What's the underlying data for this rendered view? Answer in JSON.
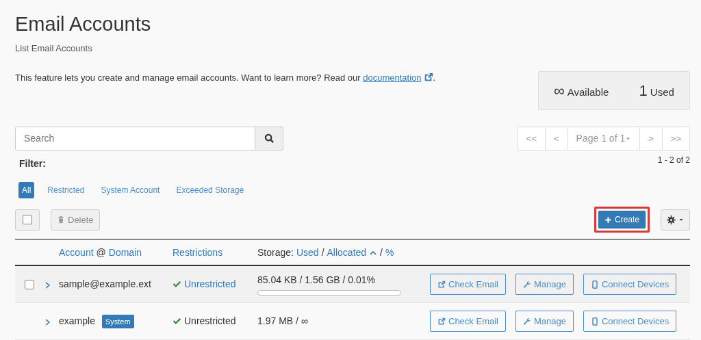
{
  "title": "Email Accounts",
  "subtitle": "List Email Accounts",
  "description": {
    "text": "This feature lets you create and manage email accounts. Want to learn more? Read our ",
    "link": "documentation",
    "end": "."
  },
  "stats": [
    {
      "value": "∞",
      "label": "Available"
    },
    {
      "value": "1",
      "label": "Used"
    }
  ],
  "search": {
    "placeholder": "Search"
  },
  "pagination": {
    "buttons": [
      {
        "label": "<<",
        "kind": "nav"
      },
      {
        "label": "<",
        "kind": "nav"
      },
      {
        "label": "Page 1 of 1",
        "kind": "dropdown"
      },
      {
        "label": ">",
        "kind": "nav"
      },
      {
        "label": ">>",
        "kind": "nav"
      }
    ],
    "count": "1 - 2 of 2"
  },
  "filter": {
    "label": "Filter:",
    "options": [
      {
        "label": "All",
        "selected": true
      },
      {
        "label": "Restricted",
        "selected": false
      },
      {
        "label": "System Account",
        "selected": false
      },
      {
        "label": "Exceeded Storage",
        "selected": false
      }
    ]
  },
  "toolbar": {
    "select_all_checked": false,
    "delete": {
      "label": "Delete",
      "disabled": true
    },
    "create": {
      "label": "Create",
      "highlighted": true
    }
  },
  "columns": [
    [
      {
        "text": "Account",
        "link": true
      },
      {
        "text": "@",
        "link": false
      },
      {
        "text": "Domain",
        "link": true
      }
    ],
    [
      {
        "text": "Restrictions",
        "link": true
      }
    ],
    [
      {
        "text": "Storage:",
        "link": false
      },
      {
        "text": "Used",
        "link": true
      },
      {
        "text": "/",
        "link": false
      },
      {
        "text": "Allocated",
        "link": true,
        "sorted": true
      },
      {
        "text": "/",
        "link": false
      },
      {
        "text": "%",
        "link": true
      }
    ]
  ],
  "rows": [
    {
      "checkbox": true,
      "checked": false,
      "account": "sample@example.ext",
      "restriction": "Unrestricted",
      "restriction_link": true,
      "storage": "85.04 KB / 1.56 GB / 0.01%",
      "level": 0.0001,
      "actions": [
        "Check Email",
        "Manage",
        "Connect Devices"
      ]
    },
    {
      "checkbox": false,
      "account": "example",
      "badge": "System",
      "restriction": "Unrestricted",
      "restriction_link": false,
      "storage": "1.97 MB / ∞",
      "actions": [
        "Check Email",
        "Manage",
        "Connect Devices"
      ]
    }
  ]
}
